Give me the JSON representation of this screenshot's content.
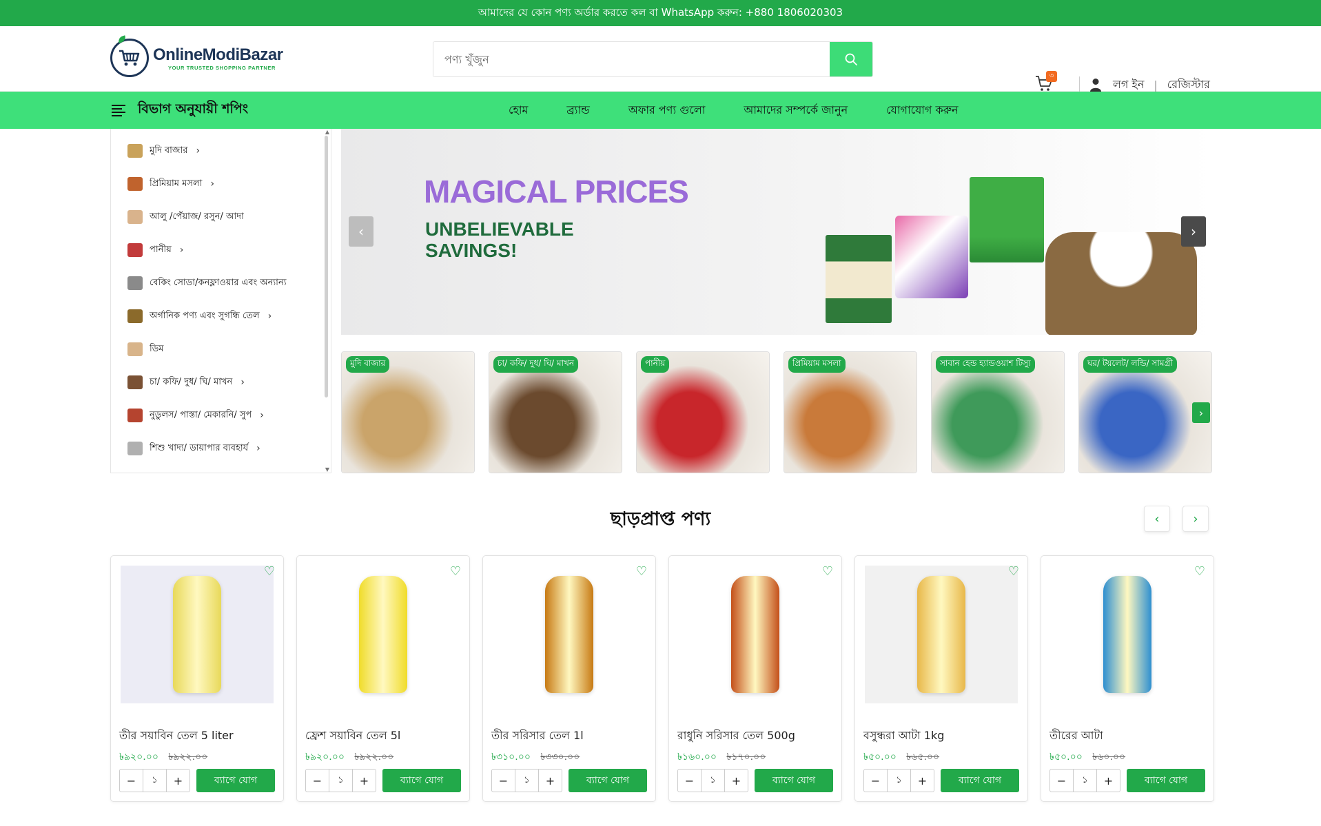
{
  "topbar": {
    "text": "আমাদের যে কোন পণ্য অর্ডার করতে কল বা WhatsApp করুন: +880 1806020303"
  },
  "logo": {
    "name": "OnlineModiBazar",
    "tagline": "YOUR TRUSTED SHOPPING PARTNER"
  },
  "search": {
    "placeholder": "পণ্য খুঁজুন"
  },
  "cart": {
    "count": "৩"
  },
  "account": {
    "login": "লগ ইন",
    "separator": "|",
    "register": "রেজিস্টার"
  },
  "nav": {
    "category_title": "বিভাগ অনুযায়ী শপিং",
    "links": [
      "হোম",
      "ব্র্যান্ড",
      "অফার পণ্য গুলো",
      "আমাদের সম্পর্কে জানুন",
      "যোগাযোগ করুন"
    ]
  },
  "sidebar": {
    "items": [
      {
        "label": "মুদি বাজার",
        "has_sub": true,
        "color": "#c9a25a"
      },
      {
        "label": "প্রিমিয়াম মসলা",
        "has_sub": true,
        "color": "#c0632d"
      },
      {
        "label": "আলু /পেঁয়াজ/ রসুন/ আদা",
        "has_sub": false,
        "color": "#d9b38c"
      },
      {
        "label": "পানীয়",
        "has_sub": true,
        "color": "#c23b3b"
      },
      {
        "label": "বেকিং সোডা/কনফ্লাওয়ার এবং অন্যান্য",
        "has_sub": false,
        "color": "#8a8a8a"
      },
      {
        "label": "অর্গানিক পণ্য এবং সুগন্ধি তেল",
        "has_sub": true,
        "color": "#8b6a2b"
      },
      {
        "label": "ডিম",
        "has_sub": false,
        "color": "#d8b48a"
      },
      {
        "label": "চা/ কফি/ দুধ/ ঘি/ মাখন",
        "has_sub": true,
        "color": "#7a5134"
      },
      {
        "label": "নুডুলস/ পাস্তা/ মেকারনি/ সুপ",
        "has_sub": true,
        "color": "#b5442f"
      },
      {
        "label": "শিশু খাদ্য/ ডায়াপার ব্যবহার্য",
        "has_sub": true,
        "color": "#b0b0b0"
      }
    ]
  },
  "banner": {
    "headline": "MAGICAL PRICES",
    "subheadline": "UNBELIEVABLE SAVINGS!"
  },
  "categories": [
    {
      "label": "মুদি বাজার",
      "color": "#caa46a"
    },
    {
      "label": "চা/ কফি/ দুধ/ ঘি/ মাখন",
      "color": "#6b4a2e"
    },
    {
      "label": "পানীয়",
      "color": "#c8262b"
    },
    {
      "label": "প্রিমিয়াম মসলা",
      "color": "#c97a3a"
    },
    {
      "label": "সাবান হেন্ড হ্যান্ডওয়াশ টিস্যু",
      "color": "#3f9a5a"
    },
    {
      "label": "ঘর/ টয়লেট/ লন্ডি/ সামগ্রী",
      "color": "#3a66c4"
    }
  ],
  "discount_section": {
    "title": "ছাড়প্রাপ্ত পণ্য"
  },
  "products": [
    {
      "name": "তীর সয়াবিন তেল 5 liter",
      "price": "৳৯২০.০০",
      "old_price": "৳৯২২.০০",
      "qty": "১",
      "add_label": "ব্যাগে যোগ",
      "bg": "#ececf5",
      "color": "#e8d95a"
    },
    {
      "name": "ফ্রেশ সয়াবিন তেল 5l",
      "price": "৳৯২০.০০",
      "old_price": "৳৯২২.০০",
      "qty": "১",
      "add_label": "ব্যাগে যোগ",
      "bg": "#ffffff",
      "color": "#f0dc2a"
    },
    {
      "name": "তীর সরিসার তেল 1l",
      "price": "৳৩১০.০০",
      "old_price": "৳৩৩০.০০",
      "qty": "১",
      "add_label": "ব্যাগে যোগ",
      "bg": "#ffffff",
      "color": "#c77a14"
    },
    {
      "name": "রাধুনি সরিসার তেল 500g",
      "price": "৳১৬০.০০",
      "old_price": "৳১৭০.০০",
      "qty": "১",
      "add_label": "ব্যাগে যোগ",
      "bg": "#ffffff",
      "color": "#c4501a"
    },
    {
      "name": "বসুন্ধরা আটা 1kg",
      "price": "৳৫০.০০",
      "old_price": "৳৬৫.০০",
      "qty": "১",
      "add_label": "ব্যাগে যোগ",
      "bg": "#f1f1f1",
      "color": "#e8b84a"
    },
    {
      "name": "তীরের আটা",
      "price": "৳৫০.০০",
      "old_price": "৳৬০.০০",
      "qty": "১",
      "add_label": "ব্যাগে যোগ",
      "bg": "#ffffff",
      "color": "#2e8fd0"
    }
  ]
}
